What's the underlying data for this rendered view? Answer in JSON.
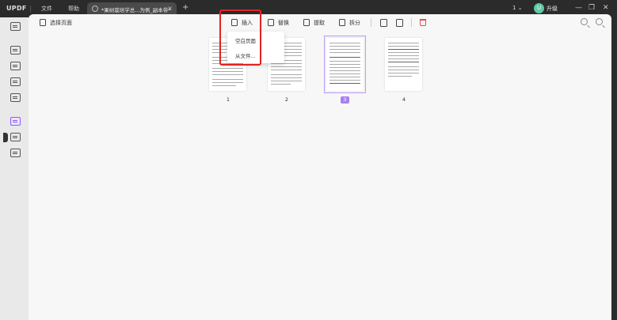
{
  "app": {
    "logo": "UPDF"
  },
  "menu": {
    "file": "文件",
    "help": "帮助"
  },
  "tab": {
    "title": "*果树栽培学总...为例_副本带*"
  },
  "titlebar": {
    "page_selector": "1",
    "upgrade_label": "升级",
    "avatar_letter": "U"
  },
  "toolbar": {
    "select_pages": "选择页面",
    "insert": "插入",
    "replace": "替换",
    "extract": "提取",
    "split": "拆分"
  },
  "dropdown": {
    "items": [
      "空白页面",
      "从文件..."
    ]
  },
  "pages": [
    {
      "number": "1",
      "selected": false
    },
    {
      "number": "2",
      "selected": false
    },
    {
      "number": "3",
      "selected": true
    },
    {
      "number": "4",
      "selected": false
    }
  ],
  "colors": {
    "accent": "#a880f0",
    "highlight": "#e32222",
    "delete": "#e54b4b"
  }
}
